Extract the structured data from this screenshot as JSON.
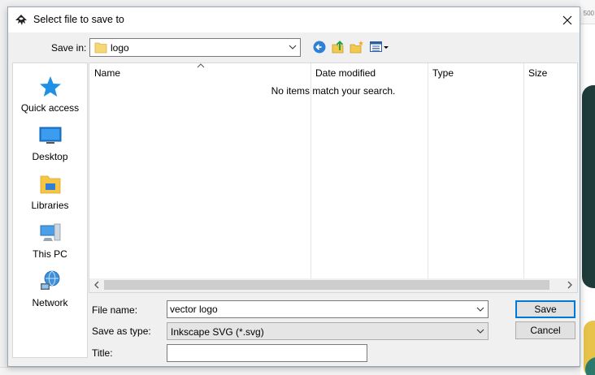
{
  "background": {
    "ruler_mark": "500"
  },
  "dialog": {
    "title": "Select file to save to",
    "save_in": {
      "label": "Save in:",
      "value": "logo"
    },
    "places": [
      {
        "label": "Quick access",
        "icon": "star-icon"
      },
      {
        "label": "Desktop",
        "icon": "desktop-icon"
      },
      {
        "label": "Libraries",
        "icon": "libraries-icon"
      },
      {
        "label": "This PC",
        "icon": "computer-icon"
      },
      {
        "label": "Network",
        "icon": "network-icon"
      }
    ],
    "columns": [
      "Name",
      "Date modified",
      "Type",
      "Size"
    ],
    "empty_message": "No items match your search.",
    "file_name": {
      "label": "File name:",
      "value": "vector logo"
    },
    "save_as_type": {
      "label": "Save as type:",
      "value": "Inkscape SVG (*.svg)"
    },
    "title_field": {
      "label": "Title:",
      "value": ""
    },
    "buttons": {
      "save": "Save",
      "cancel": "Cancel"
    }
  },
  "colors": {
    "accent": "#0078d7",
    "folder": "#f6d776",
    "star": "#1e90e6"
  }
}
